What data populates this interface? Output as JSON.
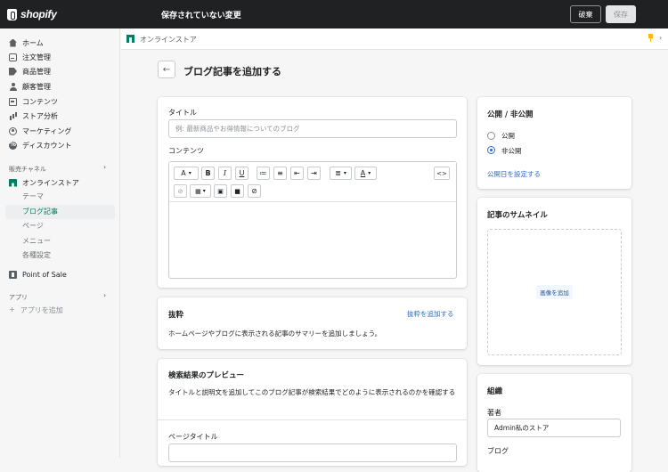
{
  "topbar": {
    "brand": "shopify",
    "unsaved_message": "保存されていない変更",
    "discard_label": "破棄",
    "save_label": "保存"
  },
  "sidebar": {
    "items": [
      {
        "label": "ホーム",
        "icon": "home-icon"
      },
      {
        "label": "注文管理",
        "icon": "orders-icon"
      },
      {
        "label": "商品管理",
        "icon": "tag-icon"
      },
      {
        "label": "顧客管理",
        "icon": "person-icon"
      },
      {
        "label": "コンテンツ",
        "icon": "content-icon"
      },
      {
        "label": "ストア分析",
        "icon": "analytics-icon"
      },
      {
        "label": "マーケティング",
        "icon": "marketing-icon"
      },
      {
        "label": "ディスカウント",
        "icon": "discount-icon"
      }
    ],
    "sales_channels_label": "販売チャネル",
    "online_store_label": "オンラインストア",
    "online_store_subitems": [
      "テーマ",
      "ブログ記事",
      "ページ",
      "メニュー",
      "各種設定"
    ],
    "active_subitem": "ブログ記事",
    "pos_label": "Point of Sale",
    "apps_label": "アプリ",
    "add_app_label": "アプリを追加"
  },
  "breadcrumb": {
    "label": "オンラインストア"
  },
  "page": {
    "title": "ブログ記事を追加する"
  },
  "main_card": {
    "title_label": "タイトル",
    "title_placeholder": "例: 最新商品やお得情報についてのブログ",
    "content_label": "コンテンツ",
    "toolbar_row1": [
      "A",
      "B",
      "I",
      "U",
      "≔",
      "≡",
      "⇤",
      "⇥",
      "≣",
      "A",
      "<>"
    ],
    "toolbar_row2": [
      "🔗",
      "▦",
      "▣",
      "■",
      "⊘"
    ]
  },
  "excerpt_card": {
    "heading": "抜粋",
    "add_link": "抜粋を追加する",
    "description": "ホームページやブログに表示される記事のサマリーを追加しましょう。"
  },
  "seo_card": {
    "heading": "検索結果のプレビュー",
    "description": "タイトルと説明文を追加してこのブログ記事が検索結果でどのように表示されるのかを確認する",
    "page_title_label": "ページタイトル"
  },
  "visibility_card": {
    "heading": "公開 / 非公開",
    "options": [
      "公開",
      "非公開"
    ],
    "selected": "非公開",
    "set_date_link": "公開日を設定する"
  },
  "thumbnail_card": {
    "heading": "記事のサムネイル",
    "add_image_label": "画像を追加"
  },
  "org_card": {
    "heading": "組織",
    "author_label": "著者",
    "author_value": "Admin私のストア",
    "blog_label": "ブログ"
  },
  "colors": {
    "topbar_bg": "#202123",
    "accent_green": "#008060",
    "link_blue": "#2c6ecb"
  }
}
